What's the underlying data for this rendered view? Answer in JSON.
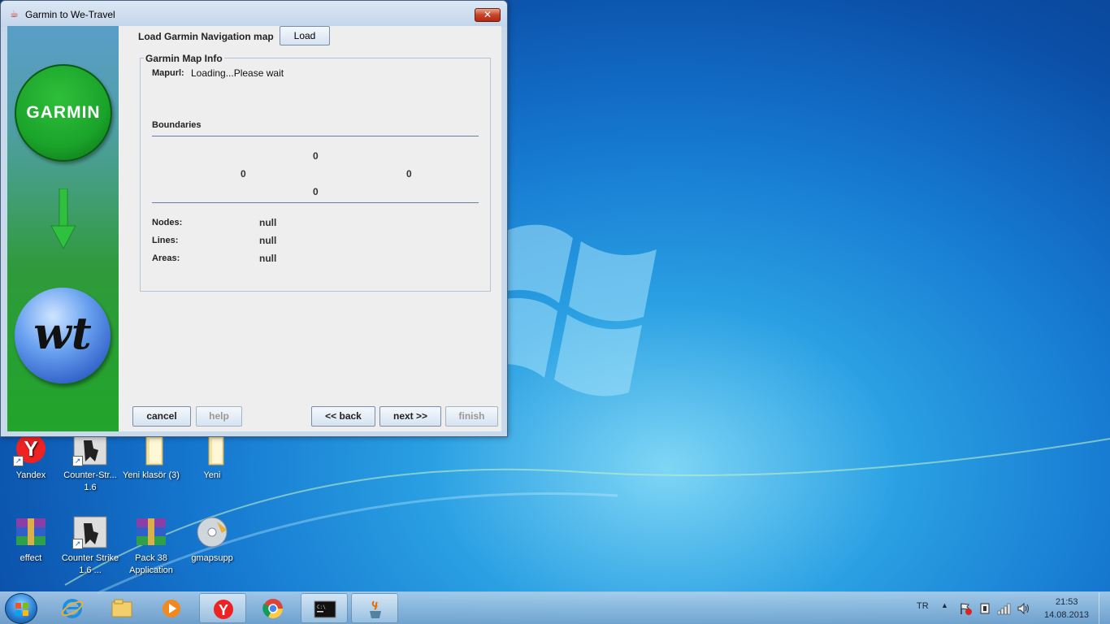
{
  "window": {
    "title": "Garmin to We-Travel",
    "close_label": "✕"
  },
  "side_panel": {
    "garmin_logo_text": "GARMIN",
    "wt_logo_text": "wt"
  },
  "load": {
    "label": "Load Garmin Navigation map",
    "button": "Load"
  },
  "map_info": {
    "title": "Garmin Map Info",
    "mapurl_label": "Mapurl:",
    "mapurl_value": "Loading...Please wait",
    "boundaries_label": "Boundaries",
    "bound_top": "0",
    "bound_left": "0",
    "bound_right": "0",
    "bound_bottom": "0",
    "nodes_label": "Nodes:",
    "nodes_value": "null",
    "lines_label": "Lines:",
    "lines_value": "null",
    "areas_label": "Areas:",
    "areas_value": "null"
  },
  "buttons": {
    "cancel": "cancel",
    "help": "help",
    "back": "<< back",
    "next": "next >>",
    "finish": "finish"
  },
  "desktop_icons": [
    {
      "label": "Yandex",
      "icon": "yandex-icon"
    },
    {
      "label": "Counter-Str... 1.6",
      "icon": "counter-strike-icon"
    },
    {
      "label": "Yeni klasör (3)",
      "icon": "folder-icon"
    },
    {
      "label": "Yeni",
      "icon": "folder-icon"
    },
    {
      "label": "effect",
      "icon": "winrar-archive-icon"
    },
    {
      "label": "Counter Strike 1.6 ...",
      "icon": "counter-strike-icon"
    },
    {
      "label": "Pack 38 Application",
      "icon": "winrar-archive-icon"
    },
    {
      "label": "gmapsupp",
      "icon": "disc-image-icon"
    }
  ],
  "taskbar": {
    "language": "TR",
    "time": "21:53",
    "date": "14.08.2013",
    "apps": [
      "internet-explorer-icon",
      "file-explorer-icon",
      "media-player-icon",
      "yandex-browser-icon",
      "chrome-icon",
      "command-prompt-icon",
      "java-icon"
    ]
  },
  "colors": {
    "garmin_green": "#1aa32a",
    "wt_blue": "#2f5fc8",
    "desktop_blue": "#1577cf"
  }
}
